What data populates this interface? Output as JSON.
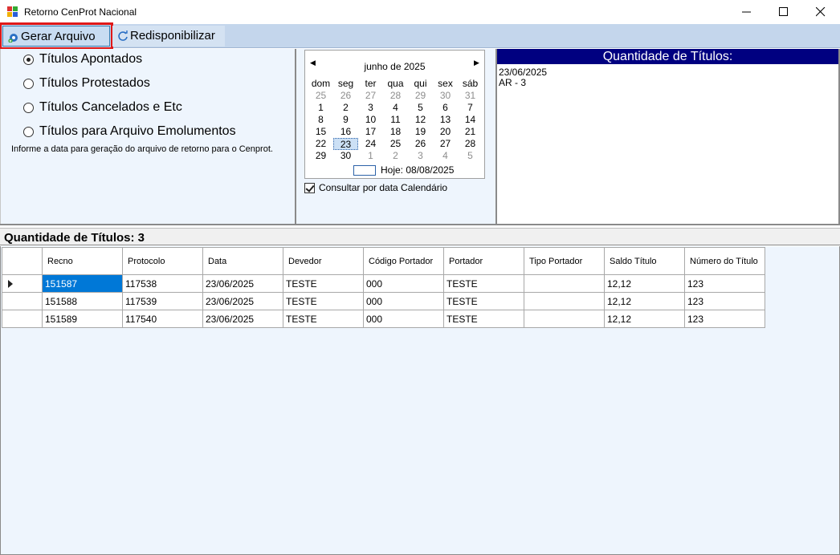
{
  "window": {
    "title": "Retorno CenProt Nacional",
    "minimize_glyph": "—",
    "maximize_glyph": "☐",
    "close_glyph": "✕"
  },
  "toolbar": {
    "gerar_label": "Gerar Arquivo",
    "redisponibilizar_label": "Redisponibilizar",
    "gerar_icon": "disk-add-icon",
    "redisponibilizar_icon": "refresh-icon",
    "highlight_color": "#e01818"
  },
  "options": {
    "items": [
      {
        "label": "Títulos Apontados",
        "selected": true
      },
      {
        "label": "Títulos Protestados",
        "selected": false
      },
      {
        "label": "Títulos Cancelados e Etc",
        "selected": false
      },
      {
        "label": "Títulos para Arquivo Emolumentos",
        "selected": false
      }
    ],
    "hint": "Informe a data para geração do arquivo de retorno para o Cenprot."
  },
  "calendar": {
    "month_label": "junho de 2025",
    "prev_glyph": "◀",
    "next_glyph": "▶",
    "weekdays": [
      "dom",
      "seg",
      "ter",
      "qua",
      "qui",
      "sex",
      "sáb"
    ],
    "weeks": [
      [
        "25",
        "26",
        "27",
        "28",
        "29",
        "30",
        "31"
      ],
      [
        "1",
        "2",
        "3",
        "4",
        "5",
        "6",
        "7"
      ],
      [
        "8",
        "9",
        "10",
        "11",
        "12",
        "13",
        "14"
      ],
      [
        "15",
        "16",
        "17",
        "18",
        "19",
        "20",
        "21"
      ],
      [
        "22",
        "23",
        "24",
        "25",
        "26",
        "27",
        "28"
      ],
      [
        "29",
        "30",
        "1",
        "2",
        "3",
        "4",
        "5"
      ]
    ],
    "selected_day": "23",
    "today_label": "Hoje: 08/08/2025",
    "checkbox_label": "Consultar por data Calendário",
    "checkbox_checked": true
  },
  "quantity_panel": {
    "header": "Quantidade de Títulos:",
    "lines": [
      "23/06/2025",
      "AR - 3"
    ],
    "header_color": "#000080"
  },
  "grid": {
    "title": "Quantidade de Títulos: 3",
    "columns": [
      "Recno",
      "Protocolo",
      "Data",
      "Devedor",
      "Código Portador",
      "Portador",
      "Tipo Portador",
      "Saldo Título",
      "Número do Título"
    ],
    "rows": [
      [
        "151587",
        "117538",
        "23/06/2025",
        "TESTE",
        "000",
        "TESTE",
        "",
        "12,12",
        "123"
      ],
      [
        "151588",
        "117539",
        "23/06/2025",
        "TESTE",
        "000",
        "TESTE",
        "",
        "12,12",
        "123"
      ],
      [
        "151589",
        "117540",
        "23/06/2025",
        "TESTE",
        "000",
        "TESTE",
        "",
        "12,12",
        "123"
      ]
    ],
    "selection_color": "#0078d7"
  }
}
